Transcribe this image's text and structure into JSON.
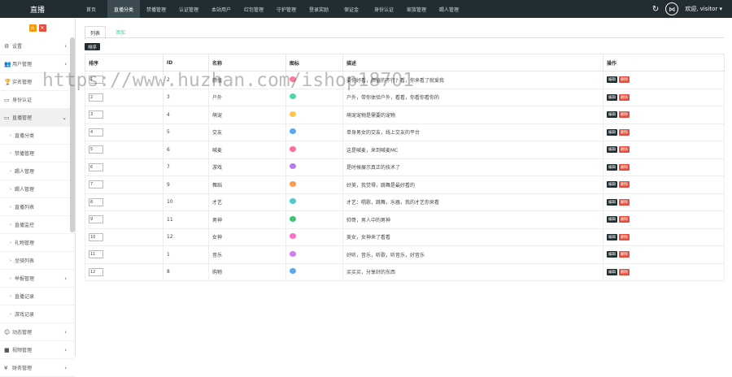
{
  "app": {
    "title": "直播",
    "user_greeting": "欢迎, visitor ▾"
  },
  "top_nav": [
    "首页",
    "直播分类",
    "禁播管理",
    "认证管理",
    "本站用户",
    "红包管理",
    "守护管理",
    "登录奖励",
    "保证金",
    "身份认证",
    "家族管理",
    "踢人管理"
  ],
  "top_nav_active": 1,
  "sidebar": {
    "items": [
      {
        "label": "设置",
        "icon": "⚙",
        "chev": "›",
        "sub": false
      },
      {
        "label": "用户管理",
        "icon": "👥",
        "chev": "›",
        "sub": false
      },
      {
        "label": "实名管理",
        "icon": "🏆",
        "chev": "",
        "sub": false
      },
      {
        "label": "身份认证",
        "icon": "▭",
        "chev": "",
        "sub": false
      },
      {
        "label": "直播管理",
        "icon": "▭",
        "chev": "⌄",
        "sub": false,
        "active": true
      },
      {
        "label": "直播分类",
        "icon": "›",
        "chev": "",
        "sub": true
      },
      {
        "label": "禁播管理",
        "icon": "›",
        "chev": "",
        "sub": true
      },
      {
        "label": "踢人管理",
        "icon": "›",
        "chev": "",
        "sub": true
      },
      {
        "label": "踢人管理",
        "icon": "›",
        "chev": "",
        "sub": true
      },
      {
        "label": "直播列表",
        "icon": "›",
        "chev": "",
        "sub": true
      },
      {
        "label": "直播监控",
        "icon": "›",
        "chev": "",
        "sub": true
      },
      {
        "label": "礼物管理",
        "icon": "›",
        "chev": "",
        "sub": true
      },
      {
        "label": "坐骑列表",
        "icon": "›",
        "chev": "",
        "sub": true
      },
      {
        "label": "举报管理",
        "icon": "›",
        "chev": "›",
        "sub": true
      },
      {
        "label": "直播记录",
        "icon": "›",
        "chev": "",
        "sub": true
      },
      {
        "label": "游戏记录",
        "icon": "›",
        "chev": "",
        "sub": true
      },
      {
        "label": "动态管理",
        "icon": "☺",
        "chev": "›",
        "sub": false
      },
      {
        "label": "视频管理",
        "icon": "■",
        "chev": "›",
        "sub": false
      },
      {
        "label": "财务管理",
        "icon": "¥",
        "chev": "›",
        "sub": false
      }
    ]
  },
  "tabs": {
    "list": "列表",
    "add": "添加"
  },
  "sort_button": "排序",
  "table": {
    "headers": [
      "排序",
      "ID",
      "名称",
      "图标",
      "描述",
      "操作"
    ],
    "rows": [
      {
        "order": "1",
        "id": "2",
        "name": "颜值",
        "color": "#ff7a9b",
        "desc": "要你好看，颜值的不行，看，你来看了就爱我"
      },
      {
        "order": "2",
        "id": "3",
        "name": "户外",
        "color": "#4cd6a0",
        "desc": "户外，带你体验户外，看看，你看你看你的"
      },
      {
        "order": "3",
        "id": "4",
        "name": "萌宠",
        "color": "#ffc54d",
        "desc": "萌宠宠物是需要的宠物"
      },
      {
        "order": "4",
        "id": "5",
        "name": "交友",
        "color": "#5aa9f0",
        "desc": "单身男女的交友，线上交友的平台"
      },
      {
        "order": "5",
        "id": "6",
        "name": "喊麦",
        "color": "#ff6b9a",
        "desc": "这是喊麦，来到喊麦MC"
      },
      {
        "order": "6",
        "id": "7",
        "name": "游戏",
        "color": "#b87bf0",
        "desc": "是时候展示真正的技术了"
      },
      {
        "order": "7",
        "id": "9",
        "name": "舞蹈",
        "color": "#ff9a4d",
        "desc": "好美，我觉得，跳舞是最好看的"
      },
      {
        "order": "8",
        "id": "10",
        "name": "才艺",
        "color": "#4dc7c7",
        "desc": "才艺：唱歌，跳舞，乐器，我的才艺你来看"
      },
      {
        "order": "9",
        "id": "11",
        "name": "男神",
        "color": "#3cc473",
        "desc": "帅哥，男人中的男神"
      },
      {
        "order": "10",
        "id": "12",
        "name": "女神",
        "color": "#ff6fc4",
        "desc": "美女，女神来了看看"
      },
      {
        "order": "11",
        "id": "1",
        "name": "音乐",
        "color": "#d47bf0",
        "desc": "好听，音乐，听歌，听音乐，好音乐"
      },
      {
        "order": "12",
        "id": "8",
        "name": "购物",
        "color": "#5aa9f0",
        "desc": "买买买，分享好的东西"
      }
    ],
    "edit_label": "编辑",
    "delete_label": "删除"
  },
  "watermark": "https://www.huzhan.com/ishop18701"
}
